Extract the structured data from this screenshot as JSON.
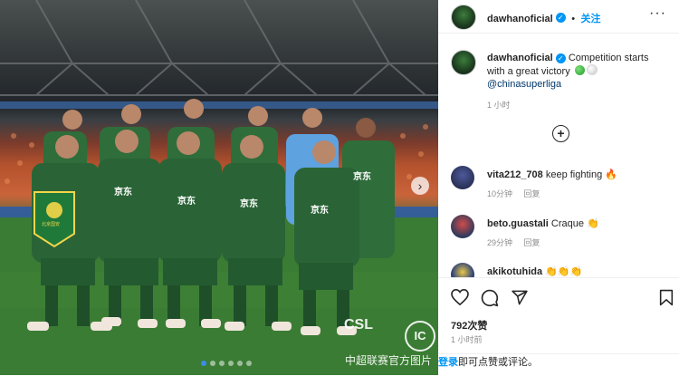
{
  "post": {
    "username": "dawhanoficial",
    "follow_label": "关注",
    "caption_text": "Competition starts with a great victory",
    "caption_mention": "@chinasuperliga",
    "caption_time": "1 小时",
    "carousel": {
      "total_slides": 6,
      "active_slide": 1
    }
  },
  "photo": {
    "watermark_logo": "CSL",
    "watermark_badge": "IC",
    "watermark_caption": "中超联赛官方图片",
    "pennant_text": "北京国安",
    "jersey_sponsor": "京东"
  },
  "comments": [
    {
      "username": "vita212_708",
      "text": "keep fighting 🔥",
      "time": "10分钟",
      "reply": "回复",
      "avatar_color": "#2a2f54"
    },
    {
      "username": "beto.guastali",
      "text": "Craque 👏",
      "time": "29分钟",
      "reply": "回复",
      "avatar_color": "#5d6c8a"
    },
    {
      "username": "akikotuhida",
      "text": "👏👏👏",
      "time": "",
      "reply": "",
      "avatar_color": "#3b4c7a"
    }
  ],
  "actions": {
    "icons": [
      "heart-icon",
      "comment-icon",
      "share-icon",
      "bookmark-icon"
    ]
  },
  "likes": "792次赞",
  "posted_time": "1 小时前",
  "login": {
    "link": "登录",
    "rest": "即可点赞或评论。"
  },
  "colors": {
    "accent": "#0095f6",
    "team_green": "#2f6d3a",
    "keeper_blue": "#5ea2df"
  }
}
